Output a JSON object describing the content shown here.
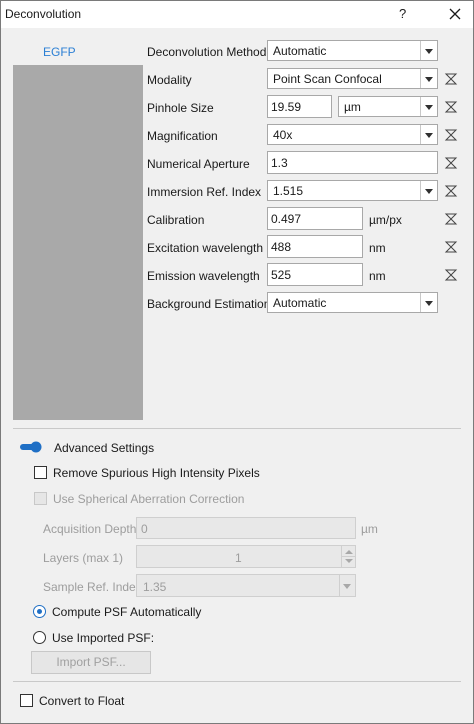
{
  "window": {
    "title": "Deconvolution",
    "help_label": "?",
    "close_icon": "close-icon"
  },
  "channel": {
    "name": "EGFP"
  },
  "params": {
    "method": {
      "label": "Deconvolution Method",
      "value": "Automatic"
    },
    "modality": {
      "label": "Modality",
      "value": "Point Scan Confocal"
    },
    "pinhole": {
      "label": "Pinhole Size",
      "value": "19.59",
      "unit": "µm"
    },
    "magnification": {
      "label": "Magnification",
      "value": "40x"
    },
    "na": {
      "label": "Numerical Aperture",
      "value": "1.3"
    },
    "immersion": {
      "label": "Immersion Ref. Index",
      "value": "1.515"
    },
    "calibration": {
      "label": "Calibration",
      "value": "0.497",
      "unit": "µm/px"
    },
    "excitation": {
      "label": "Excitation wavelength",
      "value": "488",
      "unit": "nm"
    },
    "emission": {
      "label": "Emission wavelength",
      "value": "525",
      "unit": "nm"
    },
    "background": {
      "label": "Background Estimation",
      "value": "Automatic"
    }
  },
  "advanced": {
    "toggle_label": "Advanced Settings",
    "toggle_on": true,
    "remove_spurious": {
      "label": "Remove Spurious High Intensity Pixels",
      "checked": false
    },
    "spherical": {
      "label": "Use Spherical Aberration Correction",
      "checked": false,
      "enabled": false
    },
    "acq_depth": {
      "label": "Acquisition Depth",
      "value": "0",
      "unit": "µm"
    },
    "layers": {
      "label": "Layers (max 1)",
      "value": "1"
    },
    "sample_ri": {
      "label": "Sample Ref. Index",
      "value": "1.35"
    },
    "psf_auto": {
      "label": "Compute PSF Automatically",
      "selected": true
    },
    "psf_import": {
      "label": "Use Imported PSF:",
      "selected": false
    },
    "import_button": "Import PSF..."
  },
  "convert_float": {
    "label": "Convert to Float",
    "checked": false
  },
  "colors": {
    "accent": "#1f6fc5",
    "link": "#2b7fd4",
    "panel": "#a9a9a9",
    "background": "#f0f0f0"
  }
}
